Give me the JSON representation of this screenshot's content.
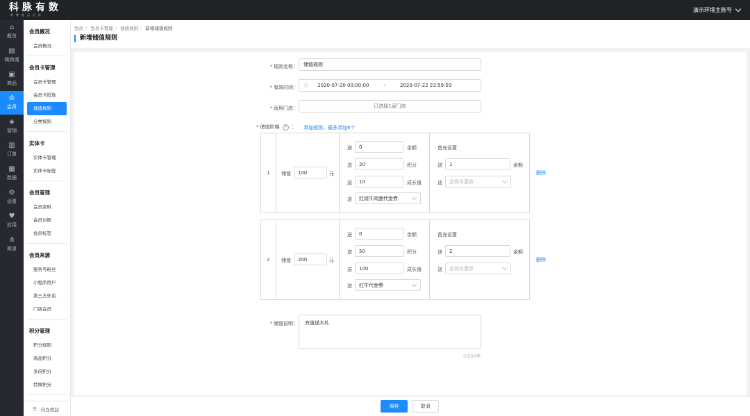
{
  "brand": {
    "name": "科脉有数",
    "slogan": "新零售云分析"
  },
  "account": {
    "label": "演示环境主账号"
  },
  "icon_nav": [
    {
      "label": "概览",
      "icon": "home-icon",
      "glyph": "⌂"
    },
    {
      "label": "微商城",
      "icon": "store-icon",
      "glyph": "▤"
    },
    {
      "label": "商品",
      "icon": "bag-icon",
      "glyph": "▣"
    },
    {
      "label": "会员",
      "icon": "crown-icon",
      "glyph": "♔"
    },
    {
      "label": "营销",
      "icon": "tag-icon",
      "glyph": "◈"
    },
    {
      "label": "订单",
      "icon": "order-icon",
      "glyph": "▥"
    },
    {
      "label": "数据",
      "icon": "chart-icon",
      "glyph": "▦"
    },
    {
      "label": "设置",
      "icon": "gear-icon",
      "glyph": "⚙"
    },
    {
      "label": "应用",
      "icon": "heart-icon",
      "glyph": "♥"
    },
    {
      "label": "渠道",
      "icon": "channel-icon",
      "glyph": "⋔"
    }
  ],
  "submenu": {
    "groups": [
      {
        "title": "会员概况",
        "items": [
          "会员概况"
        ]
      },
      {
        "title": "会员卡管理",
        "items": [
          "会员卡管理",
          "会员卡投放",
          "储值规则",
          "分类规则"
        ]
      },
      {
        "title": "实体卡",
        "items": [
          "实体卡管理",
          "实体卡标签"
        ]
      },
      {
        "title": "会员管理",
        "items": [
          "会员资料",
          "会员对账",
          "会员标签"
        ]
      },
      {
        "title": "会员来源",
        "items": [
          "服务号粉丝",
          "小程序用户",
          "第三方外卖",
          "门店会员"
        ]
      },
      {
        "title": "积分管理",
        "items": [
          "积分规则",
          "商品积分",
          "多倍积分",
          "特殊积分"
        ]
      }
    ],
    "collapse_label": "向左收起"
  },
  "breadcrumb": [
    "会员",
    "会员卡管理",
    "储值规则",
    "新增储值规则"
  ],
  "page_title": "新增储值规则",
  "form": {
    "name_label": "规则名称：",
    "name_value": "储值规则",
    "time_label": "有效时间：",
    "time_start": "2020-07-20 00:00:00",
    "time_sep": "-",
    "time_end": "2020-07-22 23:59:59",
    "store_label": "适用门店：",
    "store_value": "已选择1家门店",
    "tier_label": "储值阶梯",
    "tier_help": "?",
    "tier_add": "添加规则，最多添加6个",
    "desc_label": "储值说明：",
    "desc_value": "充值送大礼",
    "desc_count": "5/500字"
  },
  "tier_text": {
    "deposit": "储值",
    "yuan": "元",
    "give": "送",
    "balance": "余额",
    "points": "积分",
    "growth": "成长值",
    "first_title": "首充设置",
    "coupon_placeholder": "选择优惠券",
    "delete": "删除"
  },
  "tiers": [
    {
      "index": "1",
      "amount": "100",
      "balance": "0",
      "points": "20",
      "growth": "10",
      "coupon": "红烧牛肉面代金券",
      "first_balance": "1"
    },
    {
      "index": "2",
      "amount": "200",
      "balance": "0",
      "points": "50",
      "growth": "100",
      "coupon": "红牛代金券",
      "first_balance": "2"
    }
  ],
  "buttons": {
    "save": "保存",
    "cancel": "取消"
  }
}
